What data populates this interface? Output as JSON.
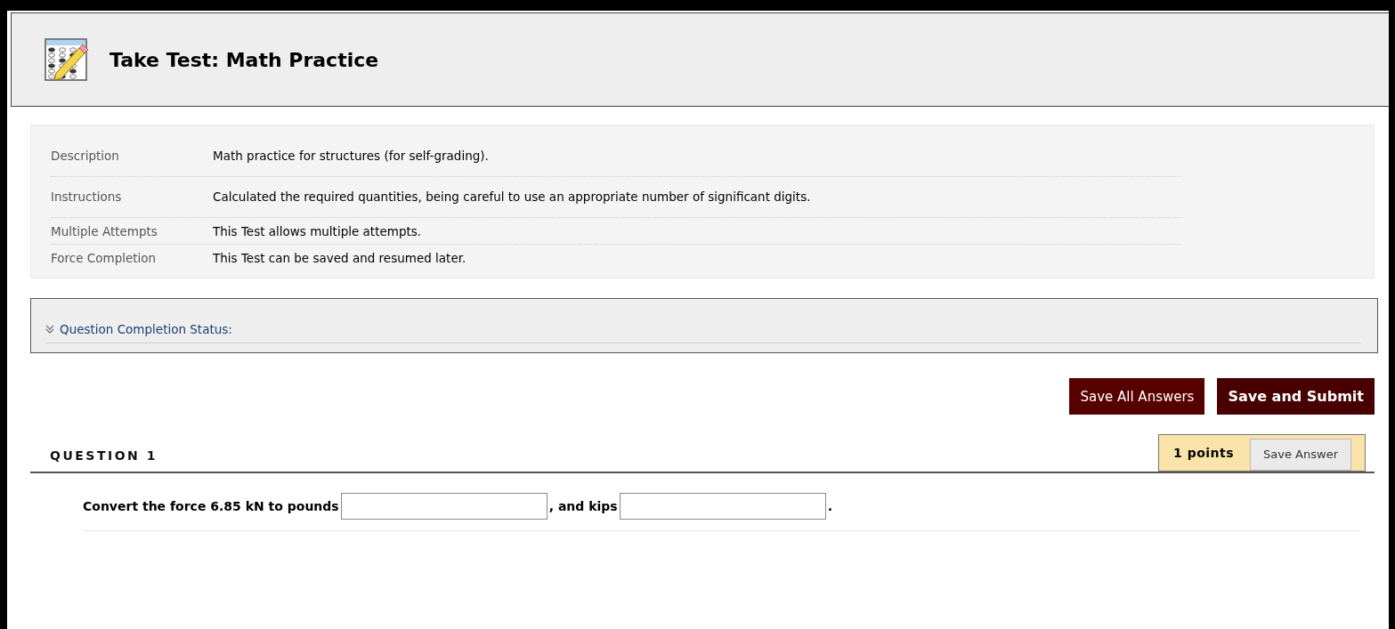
{
  "page_title": "Take Test: Math Practice",
  "info": [
    {
      "label": "Description",
      "value": "Math practice for structures (for self-grading)."
    },
    {
      "label": "Instructions",
      "value": "Calculated the required quantities, being careful to use an appropriate number of significant digits."
    },
    {
      "label": "Multiple Attempts",
      "value": "This Test allows multiple attempts."
    },
    {
      "label": "Force Completion",
      "value": "This Test can be saved and resumed later."
    }
  ],
  "completion_status": {
    "label": "Question Completion Status:",
    "expanded": false
  },
  "buttons": [
    {
      "label": "Save All Answers",
      "kind": "secondary"
    },
    {
      "label": "Save and Submit",
      "kind": "primary"
    }
  ],
  "question": {
    "heading": "QUESTION 1",
    "points": "1 points",
    "save_button": "Save Answer",
    "prompt": [
      {
        "kind": "text",
        "text": "Convert the force 6.85 kN to pounds"
      },
      {
        "kind": "field"
      },
      {
        "kind": "text",
        "text": ", and kips"
      },
      {
        "kind": "field"
      },
      {
        "kind": "text",
        "text": "."
      }
    ]
  }
}
